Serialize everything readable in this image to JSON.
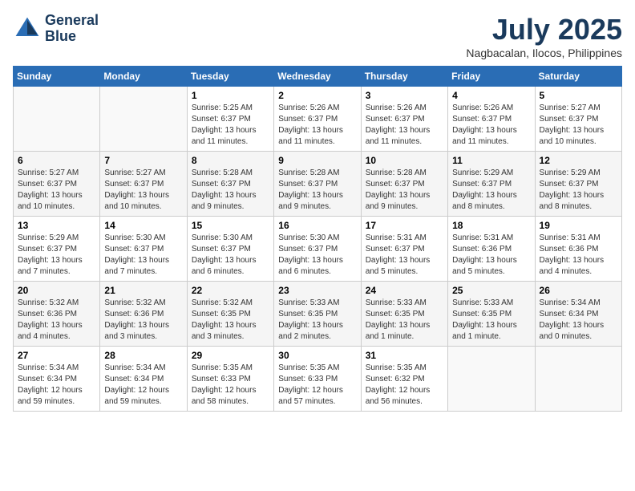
{
  "header": {
    "logo_line1": "General",
    "logo_line2": "Blue",
    "month_year": "July 2025",
    "location": "Nagbacalan, Ilocos, Philippines"
  },
  "days_of_week": [
    "Sunday",
    "Monday",
    "Tuesday",
    "Wednesday",
    "Thursday",
    "Friday",
    "Saturday"
  ],
  "weeks": [
    [
      {
        "day": "",
        "info": ""
      },
      {
        "day": "",
        "info": ""
      },
      {
        "day": "1",
        "info": "Sunrise: 5:25 AM\nSunset: 6:37 PM\nDaylight: 13 hours and 11 minutes."
      },
      {
        "day": "2",
        "info": "Sunrise: 5:26 AM\nSunset: 6:37 PM\nDaylight: 13 hours and 11 minutes."
      },
      {
        "day": "3",
        "info": "Sunrise: 5:26 AM\nSunset: 6:37 PM\nDaylight: 13 hours and 11 minutes."
      },
      {
        "day": "4",
        "info": "Sunrise: 5:26 AM\nSunset: 6:37 PM\nDaylight: 13 hours and 11 minutes."
      },
      {
        "day": "5",
        "info": "Sunrise: 5:27 AM\nSunset: 6:37 PM\nDaylight: 13 hours and 10 minutes."
      }
    ],
    [
      {
        "day": "6",
        "info": "Sunrise: 5:27 AM\nSunset: 6:37 PM\nDaylight: 13 hours and 10 minutes."
      },
      {
        "day": "7",
        "info": "Sunrise: 5:27 AM\nSunset: 6:37 PM\nDaylight: 13 hours and 10 minutes."
      },
      {
        "day": "8",
        "info": "Sunrise: 5:28 AM\nSunset: 6:37 PM\nDaylight: 13 hours and 9 minutes."
      },
      {
        "day": "9",
        "info": "Sunrise: 5:28 AM\nSunset: 6:37 PM\nDaylight: 13 hours and 9 minutes."
      },
      {
        "day": "10",
        "info": "Sunrise: 5:28 AM\nSunset: 6:37 PM\nDaylight: 13 hours and 9 minutes."
      },
      {
        "day": "11",
        "info": "Sunrise: 5:29 AM\nSunset: 6:37 PM\nDaylight: 13 hours and 8 minutes."
      },
      {
        "day": "12",
        "info": "Sunrise: 5:29 AM\nSunset: 6:37 PM\nDaylight: 13 hours and 8 minutes."
      }
    ],
    [
      {
        "day": "13",
        "info": "Sunrise: 5:29 AM\nSunset: 6:37 PM\nDaylight: 13 hours and 7 minutes."
      },
      {
        "day": "14",
        "info": "Sunrise: 5:30 AM\nSunset: 6:37 PM\nDaylight: 13 hours and 7 minutes."
      },
      {
        "day": "15",
        "info": "Sunrise: 5:30 AM\nSunset: 6:37 PM\nDaylight: 13 hours and 6 minutes."
      },
      {
        "day": "16",
        "info": "Sunrise: 5:30 AM\nSunset: 6:37 PM\nDaylight: 13 hours and 6 minutes."
      },
      {
        "day": "17",
        "info": "Sunrise: 5:31 AM\nSunset: 6:37 PM\nDaylight: 13 hours and 5 minutes."
      },
      {
        "day": "18",
        "info": "Sunrise: 5:31 AM\nSunset: 6:36 PM\nDaylight: 13 hours and 5 minutes."
      },
      {
        "day": "19",
        "info": "Sunrise: 5:31 AM\nSunset: 6:36 PM\nDaylight: 13 hours and 4 minutes."
      }
    ],
    [
      {
        "day": "20",
        "info": "Sunrise: 5:32 AM\nSunset: 6:36 PM\nDaylight: 13 hours and 4 minutes."
      },
      {
        "day": "21",
        "info": "Sunrise: 5:32 AM\nSunset: 6:36 PM\nDaylight: 13 hours and 3 minutes."
      },
      {
        "day": "22",
        "info": "Sunrise: 5:32 AM\nSunset: 6:35 PM\nDaylight: 13 hours and 3 minutes."
      },
      {
        "day": "23",
        "info": "Sunrise: 5:33 AM\nSunset: 6:35 PM\nDaylight: 13 hours and 2 minutes."
      },
      {
        "day": "24",
        "info": "Sunrise: 5:33 AM\nSunset: 6:35 PM\nDaylight: 13 hours and 1 minute."
      },
      {
        "day": "25",
        "info": "Sunrise: 5:33 AM\nSunset: 6:35 PM\nDaylight: 13 hours and 1 minute."
      },
      {
        "day": "26",
        "info": "Sunrise: 5:34 AM\nSunset: 6:34 PM\nDaylight: 13 hours and 0 minutes."
      }
    ],
    [
      {
        "day": "27",
        "info": "Sunrise: 5:34 AM\nSunset: 6:34 PM\nDaylight: 12 hours and 59 minutes."
      },
      {
        "day": "28",
        "info": "Sunrise: 5:34 AM\nSunset: 6:34 PM\nDaylight: 12 hours and 59 minutes."
      },
      {
        "day": "29",
        "info": "Sunrise: 5:35 AM\nSunset: 6:33 PM\nDaylight: 12 hours and 58 minutes."
      },
      {
        "day": "30",
        "info": "Sunrise: 5:35 AM\nSunset: 6:33 PM\nDaylight: 12 hours and 57 minutes."
      },
      {
        "day": "31",
        "info": "Sunrise: 5:35 AM\nSunset: 6:32 PM\nDaylight: 12 hours and 56 minutes."
      },
      {
        "day": "",
        "info": ""
      },
      {
        "day": "",
        "info": ""
      }
    ]
  ]
}
